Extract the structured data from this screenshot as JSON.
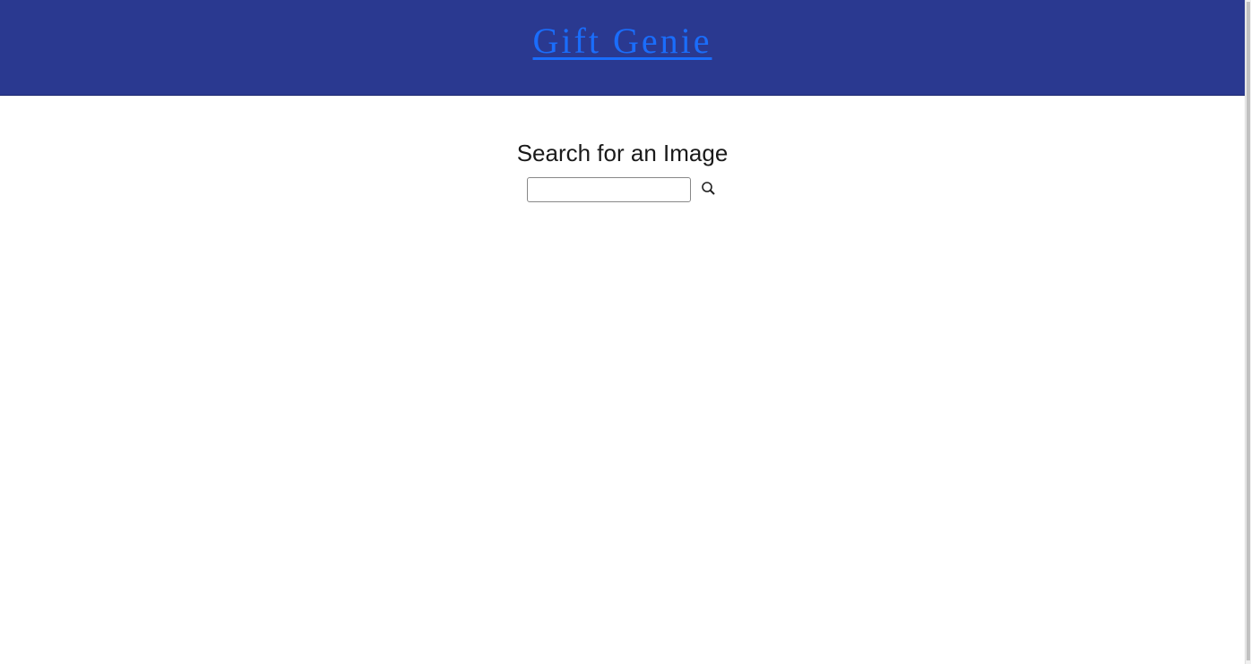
{
  "header": {
    "title": "Gift Genie",
    "background": "#2a3990",
    "link_color": "#1a6dfb"
  },
  "main": {
    "heading": "Search for an Image",
    "search": {
      "value": "",
      "placeholder": "",
      "button_icon": "search-icon"
    }
  }
}
